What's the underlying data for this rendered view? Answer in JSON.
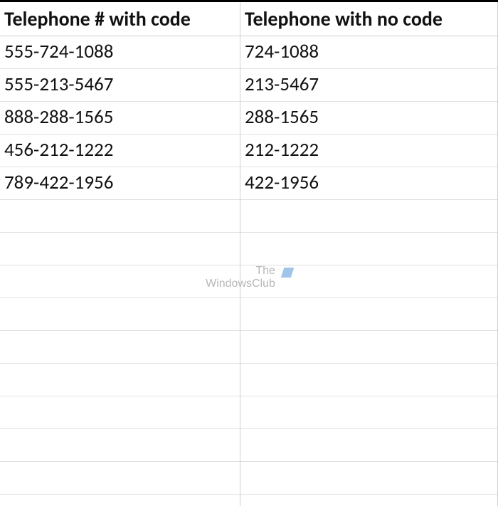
{
  "headers": {
    "col_a": "Telephone # with code",
    "col_b": "Telephone with no code"
  },
  "rows": [
    {
      "with_code": "555-724-1088",
      "no_code": "724-1088"
    },
    {
      "with_code": "555-213-5467",
      "no_code": "213-5467"
    },
    {
      "with_code": "888-288-1565",
      "no_code": "288-1565"
    },
    {
      "with_code": "456-212-1222",
      "no_code": "212-1222"
    },
    {
      "with_code": "789-422-1956",
      "no_code": "422-1956"
    }
  ],
  "empty_rows": 9,
  "watermark": {
    "line1": "The",
    "line2": "WindowsClub"
  }
}
